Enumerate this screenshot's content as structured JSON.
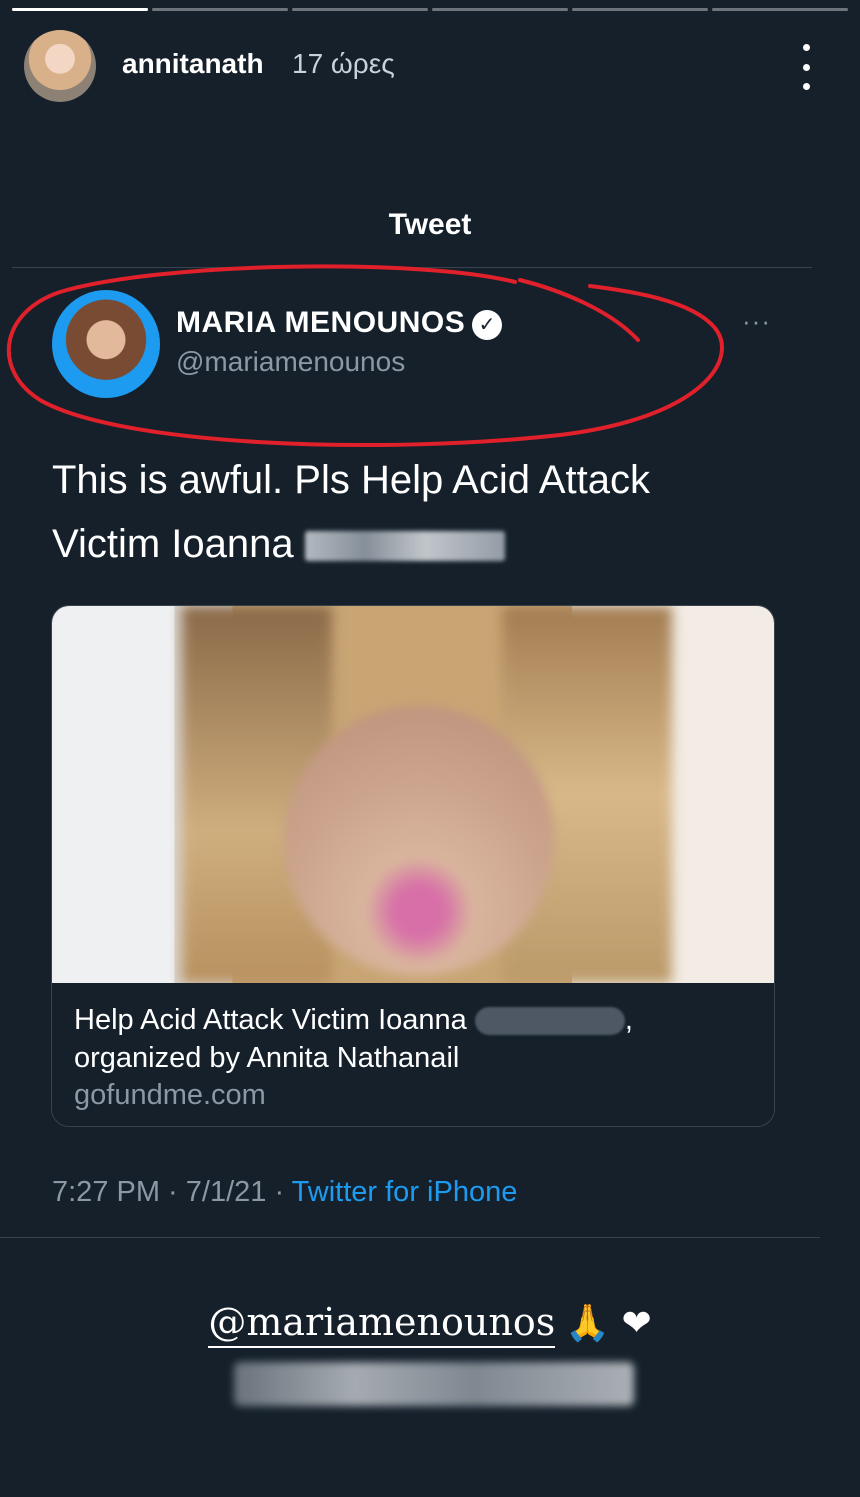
{
  "story": {
    "segments": [
      {
        "progress": 1
      },
      {
        "progress": 0
      },
      {
        "progress": 0
      },
      {
        "progress": 0
      },
      {
        "progress": 0
      },
      {
        "progress": 0
      }
    ],
    "username": "annitanath",
    "time_ago": "17 ώρες",
    "mention": "@mariamenounos",
    "emojis": "🙏 ❤"
  },
  "tweet": {
    "heading": "Tweet",
    "author_name": "MARIA MENOUNOS",
    "verified": true,
    "handle": "@mariamenounos",
    "more": "···",
    "text_line1": "This is awful.  Pls Help Acid Attack",
    "text_line2": "Victim Ioanna ",
    "card": {
      "title_a": "Help Acid Attack Victim Ioanna ",
      "title_b": ",",
      "title_c": "organized by Annita Nathanail",
      "domain": "gofundme.com"
    },
    "time": "7:27 PM",
    "date": "7/1/21",
    "source": "Twitter for iPhone",
    "separator": " · "
  },
  "colors": {
    "background": "#15202b",
    "accent": "#1d9bf0",
    "annotation": "#e0202a"
  }
}
